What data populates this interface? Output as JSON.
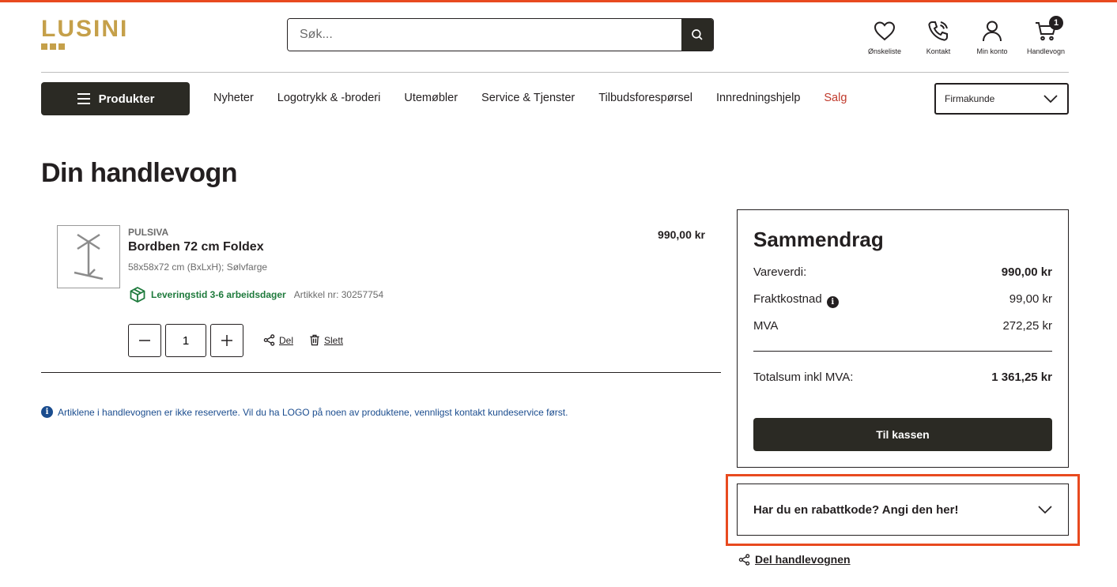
{
  "header": {
    "logo_text": "LUSINI",
    "search_placeholder": "Søk...",
    "icons": [
      {
        "name": "heart-icon",
        "label": "Ønskeliste"
      },
      {
        "name": "phone-icon",
        "label": "Kontakt"
      },
      {
        "name": "user-icon",
        "label": "Min konto"
      },
      {
        "name": "cart-icon",
        "label": "Handlevogn"
      }
    ],
    "cart_count": "1"
  },
  "nav": {
    "products_label": "Produkter",
    "items": [
      "Nyheter",
      "Logotrykk & -broderi",
      "Utemøbler",
      "Service & Tjenster",
      "Tilbudsforespørsel",
      "Innredningshjelp",
      "Salg"
    ],
    "customer_type": "Firmakunde",
    "sale_color": "#c0392b"
  },
  "page": {
    "title": "Din handlevogn"
  },
  "cart_item": {
    "brand": "PULSIVA",
    "name": "Bordben 72 cm Foldex",
    "spec": "58x58x72 cm (BxLxH); Sølvfarge",
    "delivery": "Leveringstid 3-6 arbeidsdager",
    "article_nr": "Artikkel nr: 30257754",
    "price": "990,00 kr",
    "quantity": "1",
    "share_label": "Del",
    "delete_label": "Slett"
  },
  "info_note": "Artiklene i handlevognen er ikke reserverte. Vil du ha LOGO på noen av produktene, vennligst kontakt kundeservice først.",
  "summary": {
    "title": "Sammendrag",
    "goods_label": "Vareverdi:",
    "goods_value": "990,00 kr",
    "shipping_label": "Fraktkostnad",
    "shipping_value": "99,00 kr",
    "vat_label": "MVA",
    "vat_value": "272,25 kr",
    "total_label": "Totalsum inkl MVA:",
    "total_value": "1 361,25 kr",
    "checkout_label": "Til kassen"
  },
  "discount": {
    "label": "Har du en rabattkode? Angi den her!"
  },
  "share_cart_label": "Del handlevognen",
  "colors": {
    "accent": "#e84a1f",
    "brand_gold": "#c5a04a",
    "dark": "#2b2a24",
    "delivery_green": "#1e7a3c",
    "info_blue": "#1a4c8e"
  }
}
